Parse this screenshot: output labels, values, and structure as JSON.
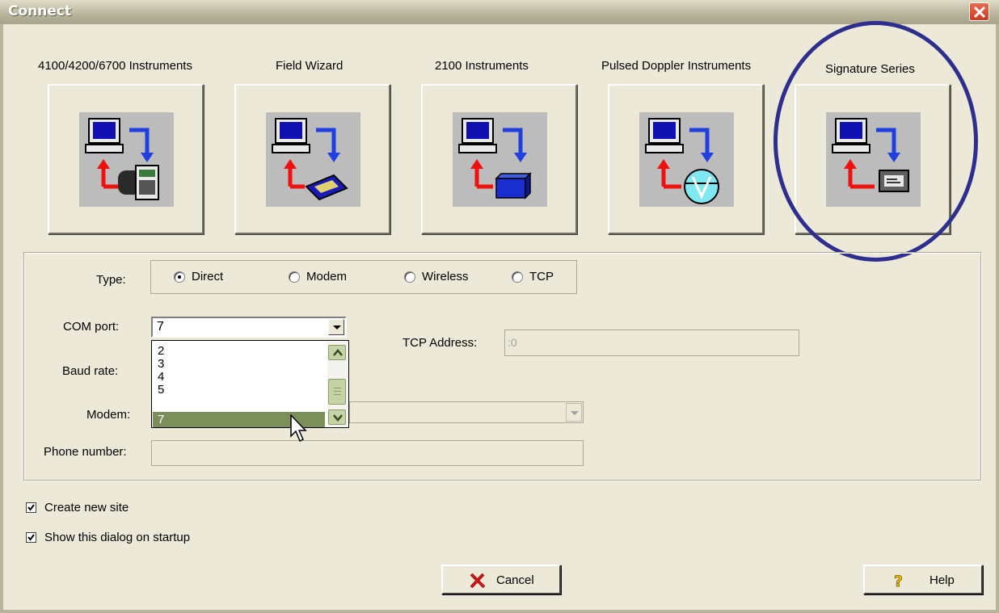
{
  "window": {
    "title": "Connect",
    "close_label": "Close"
  },
  "instruments": [
    {
      "label": "4100/4200/6700 Instruments",
      "icon": "4100-instrument-icon"
    },
    {
      "label": "Field Wizard",
      "icon": "field-wizard-icon"
    },
    {
      "label": "2100 Instruments",
      "icon": "2100-instrument-icon"
    },
    {
      "label": "Pulsed Doppler Instruments",
      "icon": "pulsed-doppler-icon"
    },
    {
      "label": "Signature Series",
      "icon": "signature-series-icon"
    }
  ],
  "type": {
    "label": "Type:",
    "options": [
      "Direct",
      "Modem",
      "Wireless",
      "TCP"
    ],
    "selected": "Direct"
  },
  "com_port": {
    "label": "COM port:",
    "value": "7",
    "options": [
      "2",
      "3",
      "4",
      "5",
      "7"
    ],
    "highlighted": "7"
  },
  "baud_rate": {
    "label": "Baud rate:"
  },
  "tcp_address": {
    "label": "TCP Address:",
    "value": ":0"
  },
  "modem": {
    "label": "Modem:"
  },
  "phone_number": {
    "label": "Phone number:"
  },
  "checkboxes": [
    {
      "label": "Create new site",
      "checked": true
    },
    {
      "label": "Show this dialog on startup",
      "checked": true
    }
  ],
  "buttons": {
    "cancel": "Cancel",
    "help": "Help"
  },
  "colors": {
    "highlight_circle": "#2e2e8e",
    "selection": "#7c8f5a",
    "dialog_bg": "#ece9d8"
  }
}
